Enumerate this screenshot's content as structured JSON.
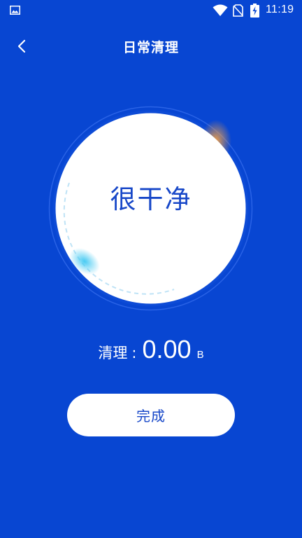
{
  "status_bar": {
    "time": "11:19",
    "icons": [
      "gallery-icon",
      "wifi-icon",
      "no-sim-icon",
      "battery-charging-icon"
    ]
  },
  "header": {
    "title": "日常清理",
    "back_icon": "chevron-left-icon"
  },
  "result": {
    "status_text": "很干净"
  },
  "cleaned": {
    "label": "清理",
    "separator": ":",
    "value": "0.00",
    "unit": "B"
  },
  "actions": {
    "done_label": "完成"
  },
  "colors": {
    "background": "#0846D2",
    "accent_text": "#1747C8",
    "circle": "#FFFFFF",
    "orange_glow": "#F5A044",
    "cyan_glow": "#3FC8F2"
  }
}
